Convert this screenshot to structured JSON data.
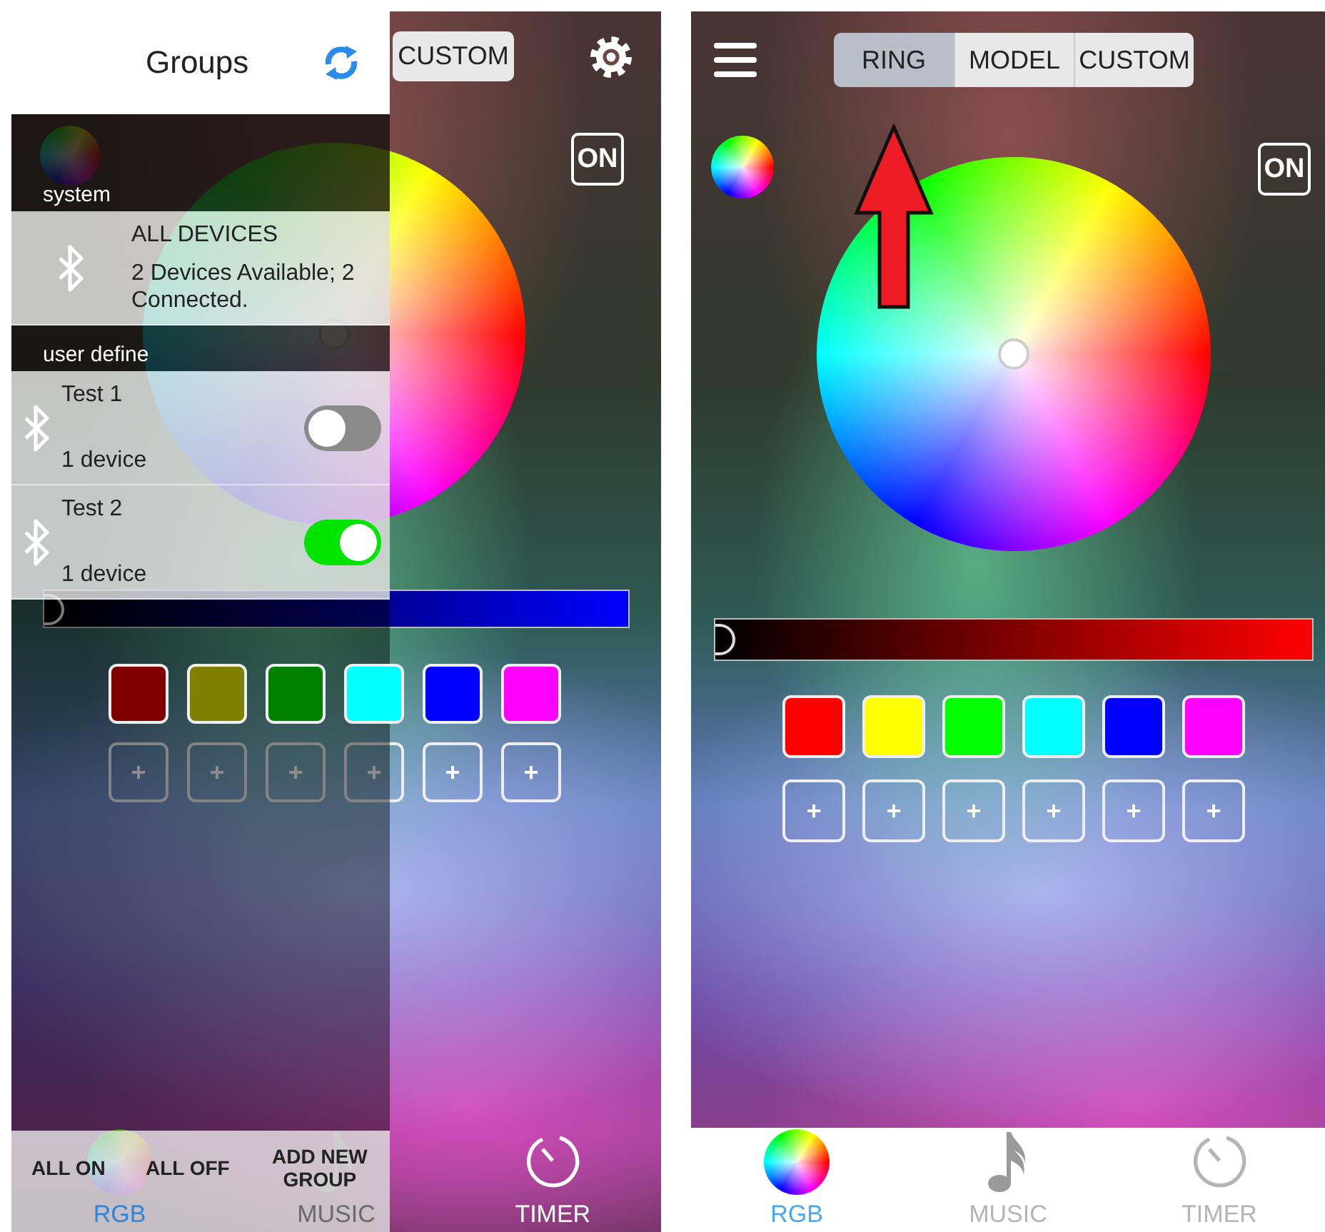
{
  "left_screen": {
    "kind": "drawer_open",
    "segments": [
      {
        "label": "CUSTOM",
        "selected": false
      }
    ],
    "power_button": "ON",
    "brightness": {
      "color": "#0000ff",
      "level": 0
    },
    "swatches": [
      {
        "color": "#800000"
      },
      {
        "color": "#808000"
      },
      {
        "color": "#008000"
      },
      {
        "color": "#00ffff"
      },
      {
        "color": "#0000ff"
      },
      {
        "color": "#ff00ff"
      }
    ],
    "add_slots": [
      "+",
      "+",
      "+",
      "+",
      "+",
      "+"
    ],
    "nav": [
      {
        "label": "RGB",
        "selected": true
      },
      {
        "label": "MUSIC",
        "selected": false
      },
      {
        "label": "TIMER",
        "selected": false
      }
    ],
    "drawer": {
      "title": "Groups",
      "sections": [
        {
          "header": "system",
          "groups": [
            {
              "name": "ALL DEVICES",
              "detail": "2 Devices Available; 2 Connected."
            }
          ]
        },
        {
          "header": "user define",
          "groups": [
            {
              "name": "Test 1",
              "detail": "1 device",
              "on": false
            },
            {
              "name": "Test 2",
              "detail": "1 device",
              "on": true
            }
          ]
        }
      ],
      "actions": [
        "ALL ON",
        "ALL OFF",
        "ADD NEW GROUP"
      ]
    }
  },
  "right_screen": {
    "kind": "main",
    "segments": [
      {
        "label": "RING",
        "selected": true
      },
      {
        "label": "MODEL",
        "selected": false
      },
      {
        "label": "CUSTOM",
        "selected": false
      }
    ],
    "power_button": "ON",
    "brightness": {
      "color": "#ff0000",
      "level": 0
    },
    "swatches": [
      {
        "color": "#ff0000"
      },
      {
        "color": "#ffff00"
      },
      {
        "color": "#00ff00"
      },
      {
        "color": "#00ffff"
      },
      {
        "color": "#0000ff"
      },
      {
        "color": "#ff00ff"
      }
    ],
    "add_slots": [
      "+",
      "+",
      "+",
      "+",
      "+",
      "+"
    ],
    "nav": [
      {
        "label": "RGB",
        "selected": true
      },
      {
        "label": "MUSIC",
        "selected": false
      },
      {
        "label": "TIMER",
        "selected": false
      }
    ]
  }
}
